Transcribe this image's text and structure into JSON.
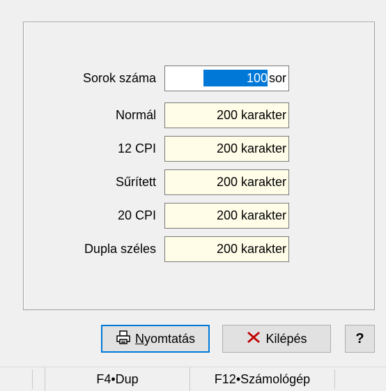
{
  "form": {
    "rows_label": "Sorok száma",
    "rows_value": "100",
    "rows_unit": "sor",
    "fields": [
      {
        "label": "Normál",
        "value": "200 karakter"
      },
      {
        "label": "12 CPI",
        "value": "200 karakter"
      },
      {
        "label": "Sűrített",
        "value": "200 karakter"
      },
      {
        "label": "20 CPI",
        "value": "200 karakter"
      },
      {
        "label": "Dupla széles",
        "value": "200 karakter"
      }
    ]
  },
  "buttons": {
    "print_first_letter": "N",
    "print_rest": "yomtatás",
    "exit_label": "Kilépés",
    "help_label": "?"
  },
  "statusbar": {
    "f4": "F4•Dup",
    "f12": "F12•Számológép"
  },
  "icons": {
    "print": "printer-icon",
    "exit": "red-x-icon",
    "help": "question-icon"
  },
  "colors": {
    "field_bg": "#fffde8",
    "selection": "#0078d7",
    "exit_x": "#c00000"
  }
}
